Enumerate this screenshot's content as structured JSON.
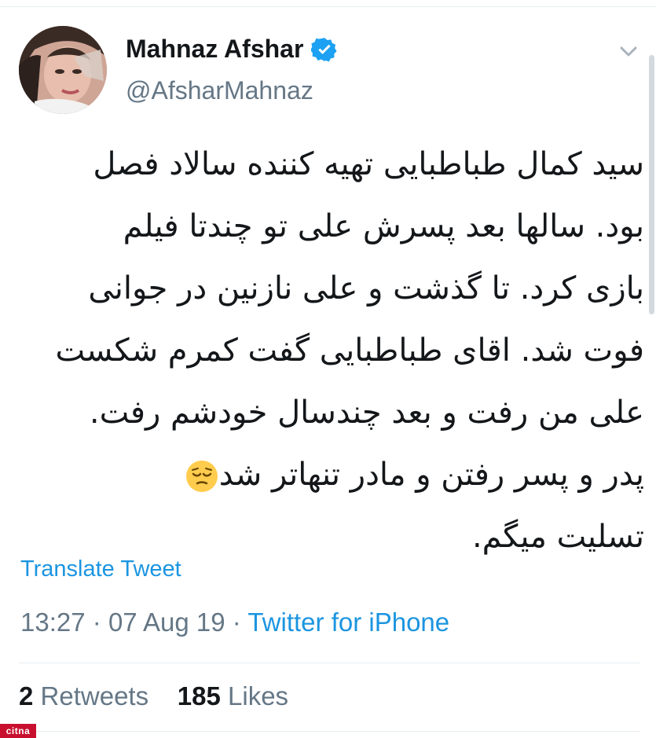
{
  "profile": {
    "name": "Mahnaz Afshar",
    "handle": "@AfsharMahnaz"
  },
  "icons": {
    "verified": "verified-badge-icon",
    "menu": "chevron-down-icon",
    "emoji": "pensive-face-emoji"
  },
  "tweet": {
    "lines": [
      "سید کمال طباطبایی تهیه کننده سالاد فصل",
      "بود. سالها بعد پسرش علی تو چندتا فیلم",
      "بازی کرد. تا گذشت و علی نازنین در جوانی",
      "فوت شد. اقای طباطبایی گفت کمرم شکست",
      "علی من رفت و بعد چندسال خودشم رفت.",
      "پدر و پسر رفتن و مادر تنهاتر شد",
      "تسلیت میگم."
    ]
  },
  "translate_label": "Translate Tweet",
  "meta": {
    "time": "13:27",
    "date": "07 Aug 19",
    "dot": "·",
    "source": "Twitter for iPhone"
  },
  "stats": {
    "retweets_count": "2",
    "retweets_label": "Retweets",
    "likes_count": "185",
    "likes_label": "Likes"
  },
  "watermark": "citna",
  "colors": {
    "link": "#1b95e0",
    "secondary_text": "#657786",
    "verified": "#1da1f2",
    "watermark_bg": "#c8102e"
  }
}
